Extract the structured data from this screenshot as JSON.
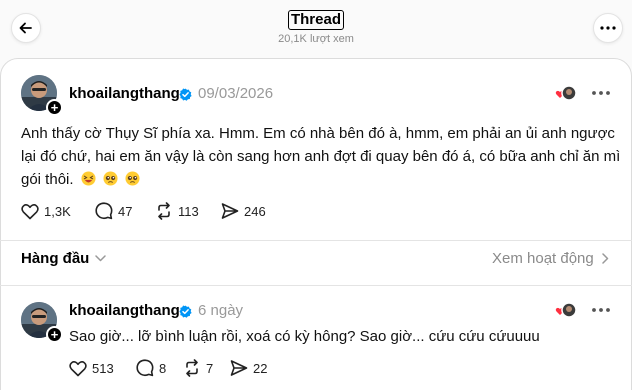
{
  "header": {
    "title": "Thread",
    "views": "20,1K lượt xem"
  },
  "post": {
    "username": "khoailangthang",
    "date": "09/03/2026",
    "text": "Anh thấy cờ Thụy Sĩ phía xa. Hmm. Em có nhà bên đó à, hmm, em phải an ủi anh ngược lại đó chứ, hai em ăn vậy là còn sang hơn anh đợt đi quay bên đó á, có bữa anh chỉ ăn mì gói thôi.",
    "emojis": [
      "grinning-squint-face",
      "pleading-face",
      "pleading-face"
    ],
    "likes": "1,3K",
    "comments": "47",
    "reposts": "113",
    "shares": "246"
  },
  "replies_bar": {
    "sort_label": "Hàng đầu",
    "activity_label": "Xem hoạt động"
  },
  "reply": {
    "username": "khoailangthang",
    "time": "6 ngày",
    "text": "Sao giờ... lỡ bình luận rồi, xoá có kỳ hông? Sao giờ... cứu cứu cứuuuu",
    "likes": "513",
    "comments": "8",
    "reposts": "7",
    "shares": "22"
  },
  "colors": {
    "verified": "#0095f6",
    "heart_react": "#ff3040",
    "muted": "#999999"
  }
}
